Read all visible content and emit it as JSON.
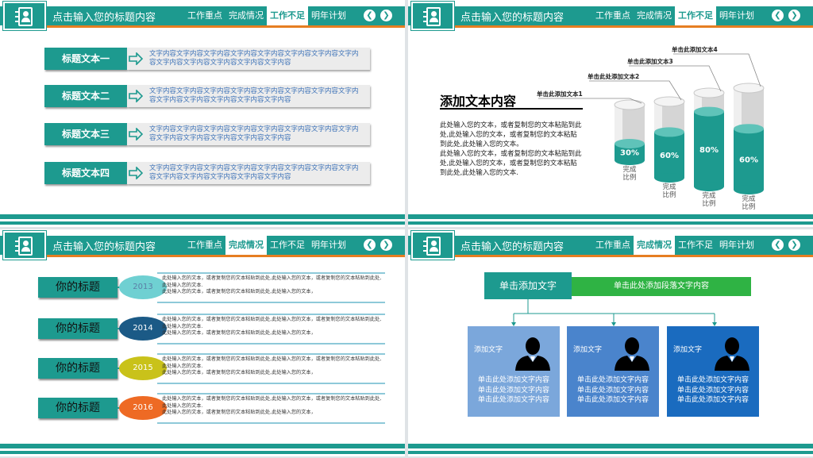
{
  "header": {
    "title": "点击输入您的标题内容",
    "tabs": [
      "工作重点",
      "完成情况",
      "工作不足",
      "明年计划"
    ],
    "prev_icon": "chevron-left-icon",
    "next_icon": "chevron-right-icon",
    "logo_icon": "user-card-icon"
  },
  "colors": {
    "teal": "#1d9a8f",
    "orange": "#e67e22",
    "green": "#2fb344",
    "blue1": "#7ba7db",
    "blue2": "#4a84cc",
    "blue3": "#1a6bbf"
  },
  "slide1": {
    "active_tab": "工作不足",
    "rows": [
      {
        "label": "标题文本一",
        "text": "文字内容文字内容文字内容文字内容文字内容文字内容文字内容文字内容文字内容文字内容文字内容文字内容文字内容"
      },
      {
        "label": "标题文本二",
        "text": "文字内容文字内容文字内容文字内容文字内容文字内容文字内容文字内容文字内容文字内容文字内容文字内容文字内容"
      },
      {
        "label": "标题文本三",
        "text": "文字内容文字内容文字内容文字内容文字内容文字内容文字内容文字内容文字内容文字内容文字内容文字内容文字内容"
      },
      {
        "label": "标题文本四",
        "text": "文字内容文字内容文字内容文字内容文字内容文字内容文字内容文字内容文字内容文字内容文字内容文字内容文字内容"
      }
    ]
  },
  "slide2": {
    "active_tab": "工作不足",
    "title": "添加文本内容",
    "body": "此处输入您的文本，或者复制您的文本粘贴到此处,此处输入您的文本，或者复制您的文本粘贴到此处,此处输入您的文本。\n此处输入您的文本，或者复制您的文本粘贴到此处,此处输入您的文本，或者复制您的文本粘贴到此处,此处输入您的文本.",
    "cylinders": [
      {
        "label": "单击此添加文本1",
        "pct": "30%",
        "value": 30,
        "caption": "完成\n比例"
      },
      {
        "label": "单击此处添加文本2",
        "pct": "60%",
        "value": 60,
        "caption": "完成\n比例"
      },
      {
        "label": "单击此添加文本3",
        "pct": "80%",
        "value": 80,
        "caption": "完成\n比例"
      },
      {
        "label": "单击此添加文本4",
        "pct": "60%",
        "value": 60,
        "caption": "完成\n比例"
      }
    ]
  },
  "slide3": {
    "active_tab": "完成情况",
    "rows": [
      {
        "label": "你的标题",
        "year": "2013",
        "color": "#6fd0d2",
        "year_color": "#5b7fa6",
        "text": "此处输入您的文本，或者复制您的文本粘贴到此处,此处输入您的文本，或者复制您的文本粘贴到此处,此处输入您的文本.\n此处输入您的文本，或者复制您的文本粘贴到此处,此处输入您的文本，"
      },
      {
        "label": "你的标题",
        "year": "2014",
        "color": "#1b5a86",
        "year_color": "#ffffff",
        "text": "此处输入您的文本，或者复制您的文本粘贴到此处,此处输入您的文本，或者复制您的文本粘贴到此处,此处输入您的文本.\n此处输入您的文本，或者复制您的文本粘贴到此处,此处输入您的文本，"
      },
      {
        "label": "你的标题",
        "year": "2015",
        "color": "#c9c21a",
        "year_color": "#ffffff",
        "text": "此处输入您的文本，或者复制您的文本粘贴到此处,此处输入您的文本，或者复制您的文本粘贴到此处,此处输入您的文本.\n此处输入您的文本，或者复制您的文本粘贴到此处,此处输入您的文本，"
      },
      {
        "label": "你的标题",
        "year": "2016",
        "color": "#ee6a24",
        "year_color": "#ffffff",
        "text": "此处输入您的文本，或者复制您的文本粘贴到此处,此处输入您的文本，或者复制您的文本粘贴到此处,此处输入您的文本.\n此处输入您的文本，或者复制您的文本粘贴到此处,此处输入您的文本，"
      }
    ]
  },
  "slide4": {
    "active_tab": "完成情况",
    "head": "单击添加文字",
    "head_desc": "单击此处添加段落文字内容",
    "cards": [
      {
        "title": "添加文字",
        "body": "单击此处添加文字内容\n单击此处添加文字内容\n单击此处添加文字内容",
        "icon": "person-icon"
      },
      {
        "title": "添加文字",
        "body": "单击此处添加文字内容\n单击此处添加文字内容\n单击此处添加文字内容",
        "icon": "person-icon"
      },
      {
        "title": "添加文字",
        "body": "单击此处添加文字内容\n单击此处添加文字内容\n单击此处添加文字内容",
        "icon": "person-icon"
      }
    ]
  }
}
